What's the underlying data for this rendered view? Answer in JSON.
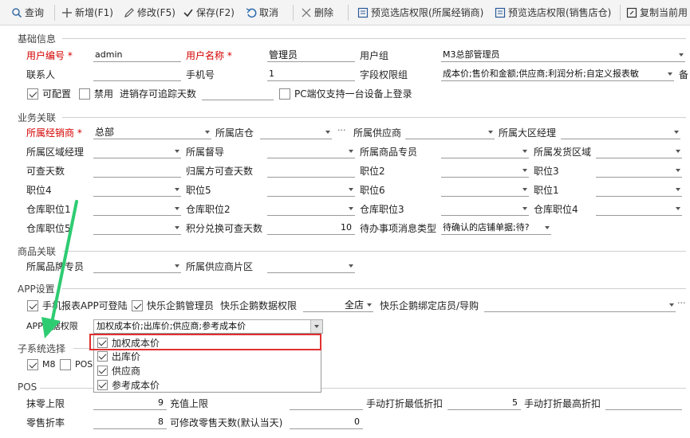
{
  "toolbar": {
    "query": "查询",
    "add": "新增(F1)",
    "edit": "修改(F5)",
    "save": "保存(F2)",
    "cancel": "取消",
    "delete": "删除",
    "preview_dealer": "预览选店权限(所属经销商)",
    "preview_sales": "预览选店权限(销售店仓)",
    "copy": "复制当前用"
  },
  "sections": {
    "basic": "基础信息",
    "business": "业务关联",
    "goods": "商品关联",
    "app": "APP设置",
    "subsys": "子系统选择",
    "pos": "POS"
  },
  "basic": {
    "user_no_label": "用户编号",
    "user_no": "admin",
    "user_name_label": "用户名称",
    "user_name": "管理员",
    "group_label": "用户组",
    "group": "M3总部管理员",
    "contact_label": "联系人",
    "contact": "",
    "mobile_label": "手机号",
    "mobile": "1",
    "field_perm_label": "字段权限组",
    "field_perm": "成本价;售价和金额;供应商;利润分析;自定义报表敏",
    "field_perm_trail": "备",
    "configurable": "可配置",
    "disabled": "禁用",
    "traceable_days_label": "进销存可追踪天数",
    "traceable_days": "",
    "pc_single": "PC端仅支持一台设备上登录",
    "star": "*"
  },
  "business": {
    "dealer_label": "所属经销商",
    "dealer": "总部",
    "store_label": "所属店仓",
    "supplier_label": "所属供应商",
    "region_mgr_label": "所属大区经理",
    "area_mgr_label": "所属区域经理",
    "supervisor_label": "所属督导",
    "goods_specialist_label": "所属商品专员",
    "ship_area_label": "所属发货区域",
    "query_days_label": "可查天数",
    "belong_query_days_label": "归属方可查天数",
    "pos2": "职位2",
    "pos3": "职位3",
    "pos4": "职位4",
    "pos5": "职位5",
    "pos6": "职位6",
    "pos1": "职位1",
    "wh_pos1": "仓库职位1",
    "wh_pos2": "仓库职位2",
    "wh_pos3": "仓库职位3",
    "wh_pos4": "仓库职位4",
    "wh_pos5": "仓库职位5",
    "points_days_label": "积分兑换可查天数",
    "points_days": "10",
    "todo_label": "待办事项消息类型",
    "todo": "待确认的店铺单据;待?"
  },
  "goods": {
    "brand_specialist_label": "所属品牌专员",
    "supplier_area_label": "所属供应商片区"
  },
  "app": {
    "report_app": "手机报表APP可登陆",
    "kuaile_admin": "快乐企鹅管理员",
    "kuaile_perm_label": "快乐企鹅数据权限",
    "kuaile_perm": "全店",
    "kuaile_bind_label": "快乐企鹅绑定店员/导购",
    "app_perm_label": "APP数据权限",
    "app_perm": "加权成本价;出库价;供应商;参考成本价",
    "options": [
      "加权成本价",
      "出库价",
      "供应商",
      "参考成本价"
    ]
  },
  "subsys": {
    "m8": "M8",
    "pos": "POS"
  },
  "pos": {
    "zero_limit_label": "抹零上限",
    "zero_limit": "9",
    "recharge_limit_label": "充值上限",
    "recharge_limit": "",
    "min_discount_label": "手动打折最低折扣",
    "min_discount": "5",
    "max_discount_label": "手动打折最高折扣",
    "max_discount": "",
    "retail_discount_label": "零售折率",
    "retail_discount": "8",
    "edit_days_label": "可修改零售天数(默认当天)",
    "edit_days": "0"
  },
  "colors": {
    "required": "#d40000",
    "highlight": "#e03030",
    "arrow": "#2ecc71"
  },
  "icons": [
    "search-icon",
    "plus-icon",
    "edit-icon",
    "check-icon",
    "undo-icon",
    "close-icon",
    "preview-icon",
    "copy-icon",
    "chevron-down-icon",
    "ellipsis-icon",
    "checkbox-icon",
    "arrow-annotation"
  ]
}
